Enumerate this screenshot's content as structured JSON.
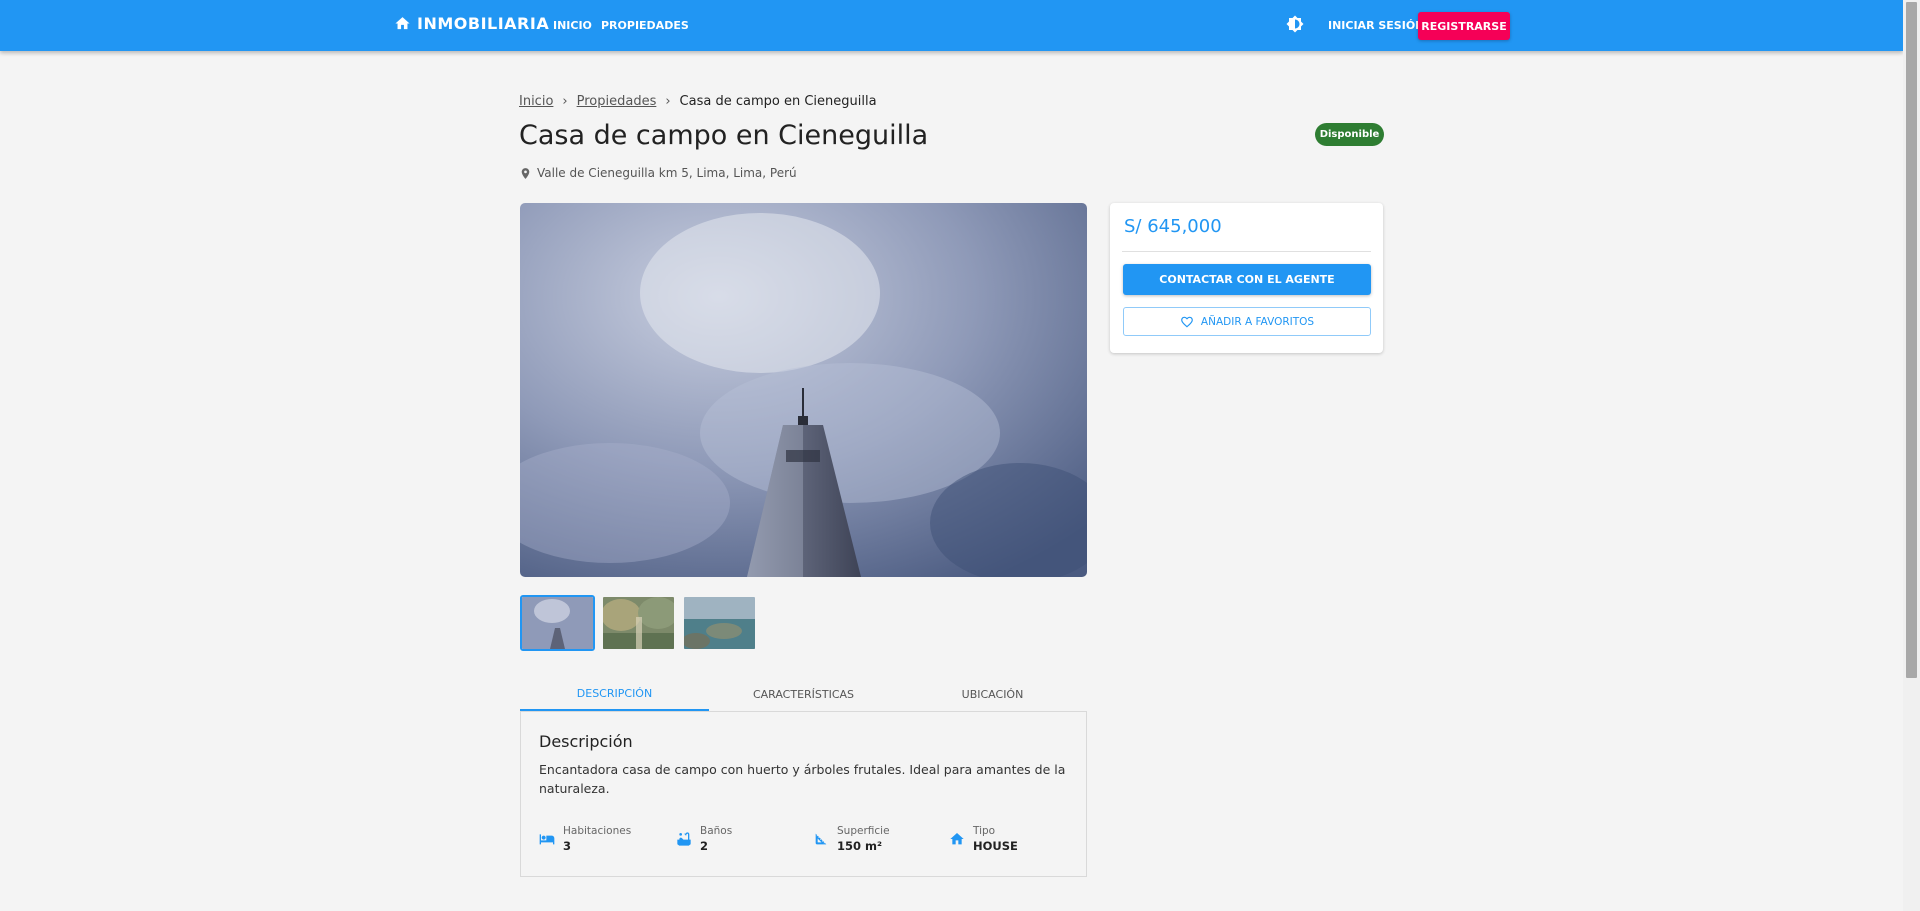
{
  "header": {
    "brand": "INMOBILIARIA",
    "nav": [
      "INICIO",
      "PROPIEDADES"
    ],
    "login": "INICIAR SESIÓN",
    "register": "REGISTRARSE"
  },
  "breadcrumb": {
    "home": "Inicio",
    "properties": "Propiedades",
    "current": "Casa de campo en Cieneguilla"
  },
  "property": {
    "title": "Casa de campo en Cieneguilla",
    "status": "Disponible",
    "address": "Valle de Cieneguilla km 5, Lima, Lima, Perú",
    "price": "S/ 645,000"
  },
  "actions": {
    "contact": "CONTACTAR CON EL AGENTE",
    "favorite": "AÑADIR A FAVORITOS"
  },
  "tabs": [
    "DESCRIPCIÓN",
    "CARACTERÍSTICAS",
    "UBICACIÓN"
  ],
  "description": {
    "title": "Descripción",
    "text": "Encantadora casa de campo con huerto y árboles frutales. Ideal para amantes de la naturaleza."
  },
  "features": [
    {
      "label": "Habitaciones",
      "value": "3",
      "icon": "bed-icon"
    },
    {
      "label": "Baños",
      "value": "2",
      "icon": "bathtub-icon"
    },
    {
      "label": "Superficie",
      "value": "150 m²",
      "icon": "area-icon"
    },
    {
      "label": "Tipo",
      "value": "HOUSE",
      "icon": "home-icon"
    }
  ],
  "colors": {
    "primary": "#2196f3",
    "accent": "#f50057",
    "status": "#2e7d32"
  }
}
